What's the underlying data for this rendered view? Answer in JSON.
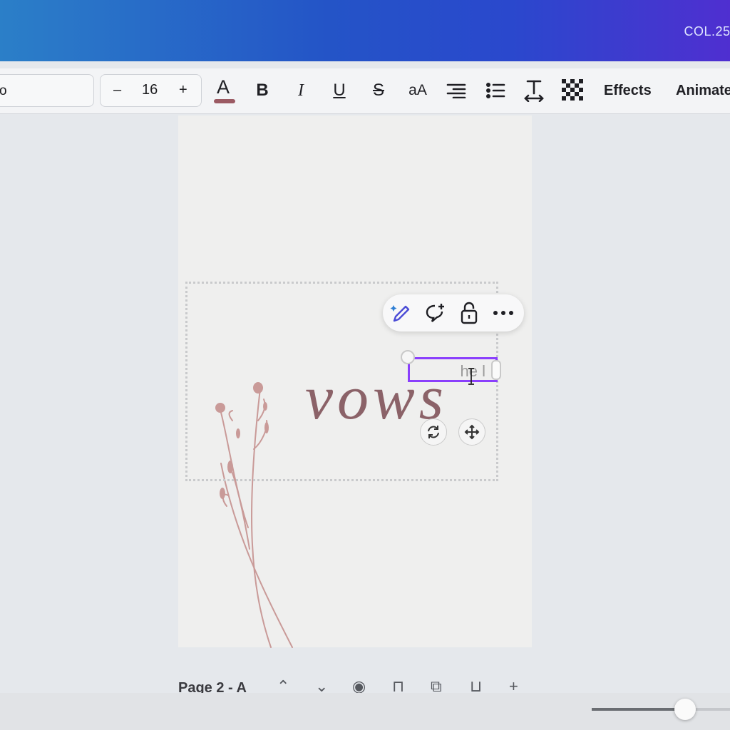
{
  "header": {
    "doc_title": "COL.25."
  },
  "toolbar": {
    "font_name": "o",
    "size_decrease": "–",
    "font_size": "16",
    "size_increase": "+",
    "text_color_glyph": "A",
    "text_color_hex": "#9b5a63",
    "case_label": "aA",
    "effects_label": "Effects",
    "animate_label": "Animate"
  },
  "canvas": {
    "typed_text": "he l",
    "script_word": "vows",
    "accent_color": "#8a3ffc",
    "ink_color": "#8b6268"
  },
  "floating_menu": {
    "items": [
      "magic-edit-icon",
      "add-comment-icon",
      "lock-icon",
      "more-icon"
    ]
  },
  "footer": {
    "page_label": "Page 2 - A",
    "zoom_level_fraction": 0.67
  }
}
